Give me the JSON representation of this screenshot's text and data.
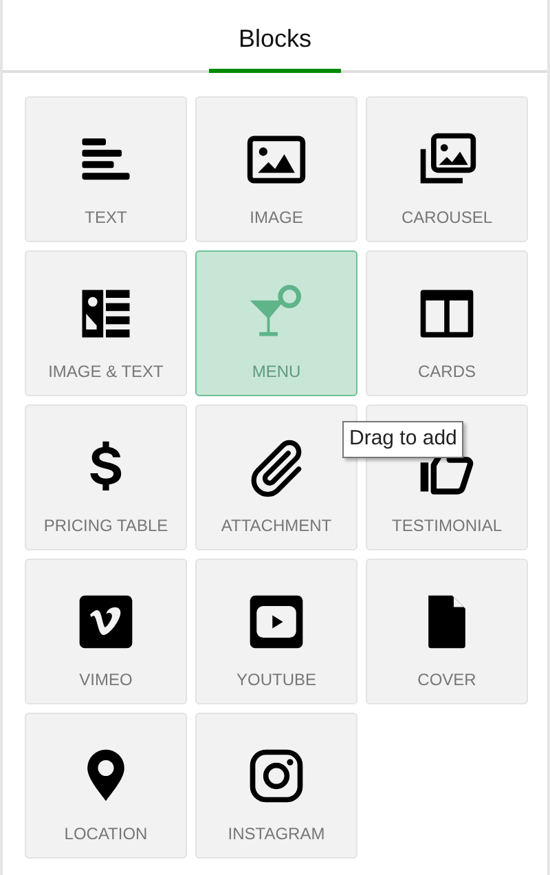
{
  "tabs": [
    {
      "label": "Blocks",
      "selected": true
    }
  ],
  "blocks": [
    {
      "label": "TEXT",
      "selected": false
    },
    {
      "label": "IMAGE",
      "selected": false
    },
    {
      "label": "CAROUSEL",
      "selected": false
    },
    {
      "label": "IMAGE & TEXT",
      "selected": false
    },
    {
      "label": "MENU",
      "selected": true
    },
    {
      "label": "CARDS",
      "selected": false
    },
    {
      "label": "PRICING TABLE",
      "selected": false
    },
    {
      "label": "ATTACHMENT",
      "selected": false
    },
    {
      "label": "TESTIMONIAL",
      "selected": false
    },
    {
      "label": "VIMEO",
      "selected": false
    },
    {
      "label": "YOUTUBE",
      "selected": false
    },
    {
      "label": "COVER",
      "selected": false
    },
    {
      "label": "LOCATION",
      "selected": false
    },
    {
      "label": "INSTAGRAM",
      "selected": false
    }
  ],
  "tooltip": "Drag to add"
}
